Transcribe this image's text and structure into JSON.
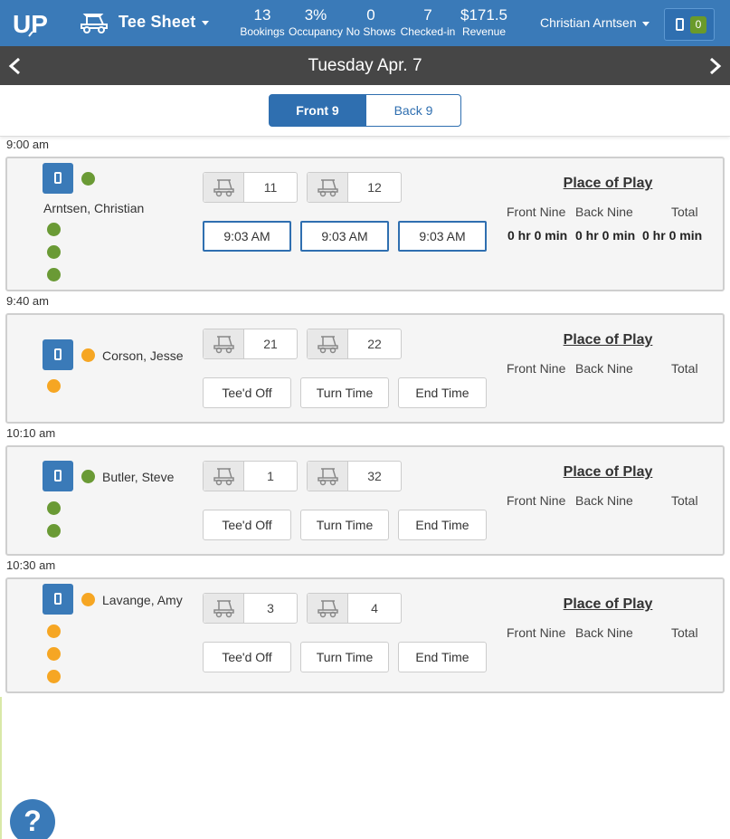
{
  "header": {
    "logo_text": "UP",
    "app_title": "Tee Sheet",
    "stats": [
      {
        "value": "13",
        "label": "Bookings"
      },
      {
        "value": "3%",
        "label": "Occupancy"
      },
      {
        "value": "0",
        "label": "No Shows"
      },
      {
        "value": "7",
        "label": "Checked-in"
      },
      {
        "value": "$171.5",
        "label": "Revenue"
      }
    ],
    "user_name": "Christian Arntsen",
    "mobile_count": "0",
    "bar_color": "#3a7ab8"
  },
  "datebar": {
    "date": "Tuesday Apr. 7"
  },
  "toggle": {
    "front": "Front 9",
    "back": "Back 9",
    "active": "front"
  },
  "place_of_play": {
    "title": "Place of Play",
    "front_nine": "Front Nine",
    "back_nine": "Back Nine",
    "total": "Total"
  },
  "actions": {
    "teed_off": "Tee'd Off",
    "turn_time": "Turn Time",
    "end_time": "End Time"
  },
  "slots": [
    {
      "time": "9:00 am",
      "player": "Arntsen, Christian",
      "status_color": "green",
      "cart_a": "11",
      "cart_b": "12",
      "recorded_times": [
        "9:03 AM",
        "9:03 AM",
        "9:03 AM"
      ],
      "durations": [
        "0 hr 0 min",
        "0 hr 0 min",
        "0 hr 0 min"
      ]
    },
    {
      "time": "9:40 am",
      "player": "Corson, Jesse",
      "status_color": "orange",
      "cart_a": "21",
      "cart_b": "22"
    },
    {
      "time": "10:10 am",
      "player": "Butler, Steve",
      "status_color": "green",
      "cart_a": "1",
      "cart_b": "32"
    },
    {
      "time": "10:30 am",
      "player": "Lavange, Amy",
      "status_color": "orange",
      "cart_a": "3",
      "cart_b": "4"
    }
  ],
  "help_label": "?"
}
